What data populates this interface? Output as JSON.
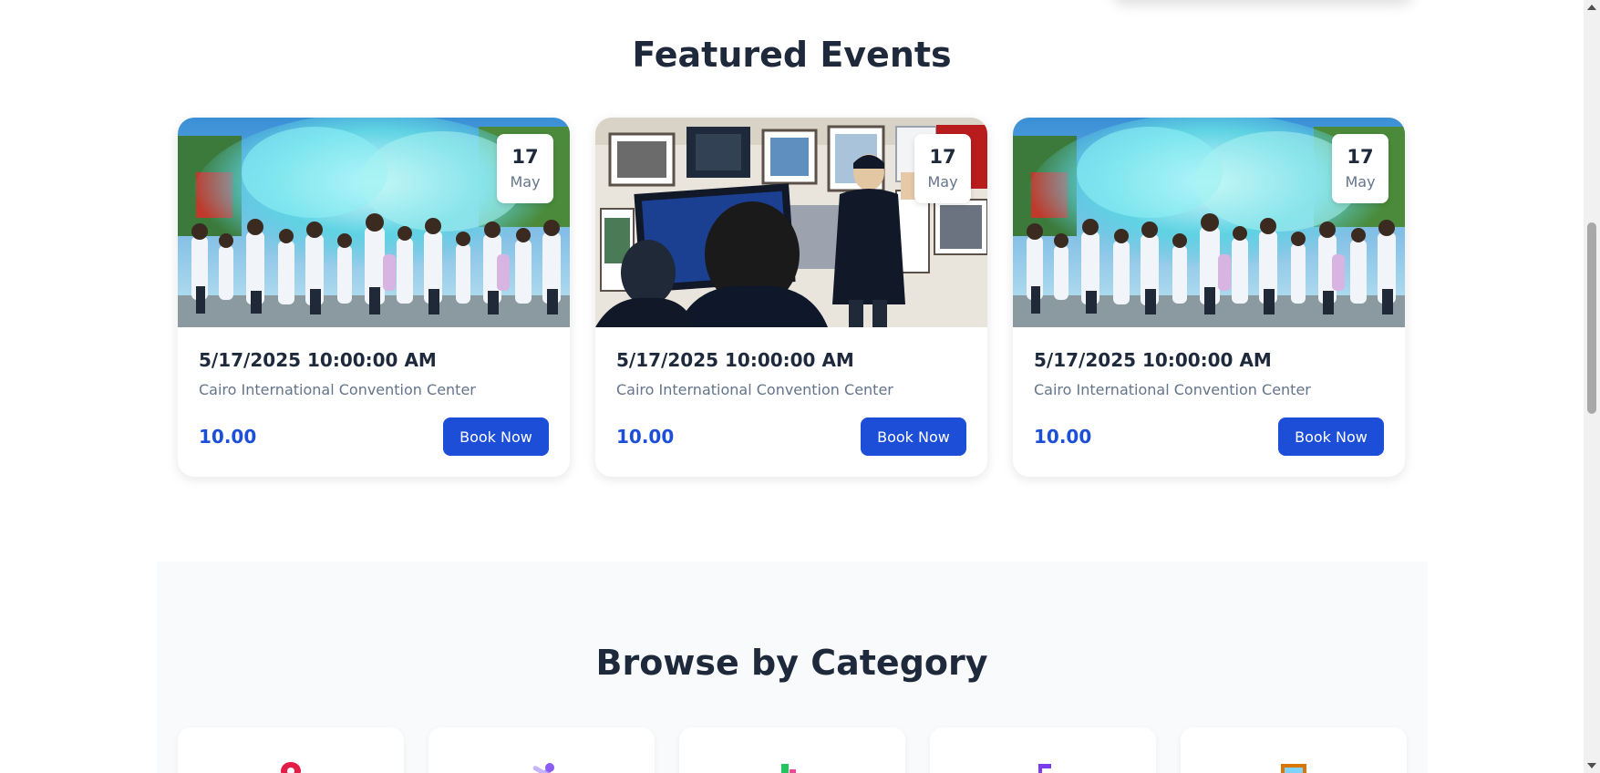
{
  "featured": {
    "title": "Featured Events",
    "events": [
      {
        "image": "festival-color-crowd-photo",
        "day": "17",
        "month": "May",
        "datetime": "5/17/2025 10:00:00 AM",
        "venue": "Cairo International Convention Center",
        "price": "10.00",
        "book_label": "Book Now"
      },
      {
        "image": "photography-exhibition-photo",
        "day": "17",
        "month": "May",
        "datetime": "5/17/2025 10:00:00 AM",
        "venue": "Cairo International Convention Center",
        "price": "10.00",
        "book_label": "Book Now"
      },
      {
        "image": "festival-color-crowd-photo",
        "day": "17",
        "month": "May",
        "datetime": "5/17/2025 10:00:00 AM",
        "venue": "Cairo International Convention Center",
        "price": "10.00",
        "book_label": "Book Now"
      }
    ]
  },
  "categories": {
    "title": "Browse by Category",
    "items": [
      {
        "icon": "map-pin-icon",
        "color": "#e11d48"
      },
      {
        "icon": "tools-icon",
        "color": "#a78bfa"
      },
      {
        "icon": "books-icon",
        "color": "#22c55e"
      },
      {
        "icon": "music-note-icon",
        "color": "#7c3aed"
      },
      {
        "icon": "picture-frame-icon",
        "color": "#d97706"
      }
    ]
  },
  "colors": {
    "accent": "#1d4ed8",
    "heading": "#1e293b",
    "muted": "#64748b"
  }
}
